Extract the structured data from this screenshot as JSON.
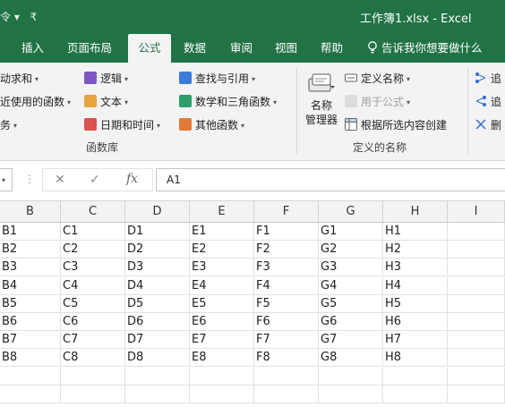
{
  "titlebar": {
    "qat_left": "令 ▾",
    "qat_right": "₹",
    "title": "工作簿1.xlsx  -  Excel"
  },
  "tabs": [
    {
      "label": "插入"
    },
    {
      "label": "页面布局"
    },
    {
      "label": "公式",
      "active": true
    },
    {
      "label": "数据"
    },
    {
      "label": "审阅"
    },
    {
      "label": "视图"
    },
    {
      "label": "帮助"
    },
    {
      "label": "告诉我你想要做什么",
      "icon": "lightbulb-icon"
    }
  ],
  "ribbon": {
    "function_library": {
      "col1": [
        {
          "label": "动求和",
          "arrow": "▾"
        },
        {
          "label": "近使用的函数",
          "arrow": "▾"
        },
        {
          "label": "务",
          "arrow": "▾"
        }
      ],
      "col2": [
        {
          "label": "逻辑",
          "arrow": "▾",
          "icon": "logical-icon",
          "color": "#7e57c2"
        },
        {
          "label": "文本",
          "arrow": "▾",
          "icon": "text-icon",
          "color": "#e8a33d"
        },
        {
          "label": "日期和时间",
          "arrow": "▾",
          "icon": "date-time-icon",
          "color": "#d9534f"
        }
      ],
      "col3": [
        {
          "label": "查找与引用",
          "arrow": "▾",
          "icon": "lookup-icon",
          "color": "#3b7dd8"
        },
        {
          "label": "数学和三角函数",
          "arrow": "▾",
          "icon": "math-trig-icon",
          "color": "#2e9e6b"
        },
        {
          "label": "其他函数",
          "arrow": "▾",
          "icon": "more-functions-icon",
          "color": "#e07b39"
        }
      ],
      "group_label": "函数库"
    },
    "defined_names": {
      "name_manager_line1": "名称",
      "name_manager_line2": "管理器",
      "define_name": "定义名称",
      "define_name_arrow": "▾",
      "use_in_formula": "用于公式",
      "use_in_formula_arrow": "▾",
      "create_from_selection": "根据所选内容创建",
      "group_label": "定义的名称"
    },
    "auditing": {
      "trace_precedents": "追",
      "trace_dependents": "追",
      "remove_arrows": "删"
    }
  },
  "formula_bar": {
    "namebox_arrow": "▾",
    "dots": "⋮",
    "cancel": "✕",
    "enter": "✓",
    "fx": "fx",
    "content": "A1"
  },
  "grid": {
    "columns": [
      "B",
      "C",
      "D",
      "E",
      "F",
      "G",
      "H",
      "I"
    ],
    "rows": [
      [
        "B1",
        "C1",
        "D1",
        "E1",
        "F1",
        "G1",
        "H1",
        ""
      ],
      [
        "B2",
        "C2",
        "D2",
        "E2",
        "F2",
        "G2",
        "H2",
        ""
      ],
      [
        "B3",
        "C3",
        "D3",
        "E3",
        "F3",
        "G3",
        "H3",
        ""
      ],
      [
        "B4",
        "C4",
        "D4",
        "E4",
        "F4",
        "G4",
        "H4",
        ""
      ],
      [
        "B5",
        "C5",
        "D5",
        "E5",
        "F5",
        "G5",
        "H5",
        ""
      ],
      [
        "B6",
        "C6",
        "D6",
        "E6",
        "F6",
        "G6",
        "H6",
        ""
      ],
      [
        "B7",
        "C7",
        "D7",
        "E7",
        "F7",
        "G7",
        "H7",
        ""
      ],
      [
        "B8",
        "C8",
        "D8",
        "E8",
        "F8",
        "G8",
        "H8",
        ""
      ],
      [
        "",
        "",
        "",
        "",
        "",
        "",
        "",
        ""
      ],
      [
        "",
        "",
        "",
        "",
        "",
        "",
        "",
        ""
      ]
    ]
  }
}
